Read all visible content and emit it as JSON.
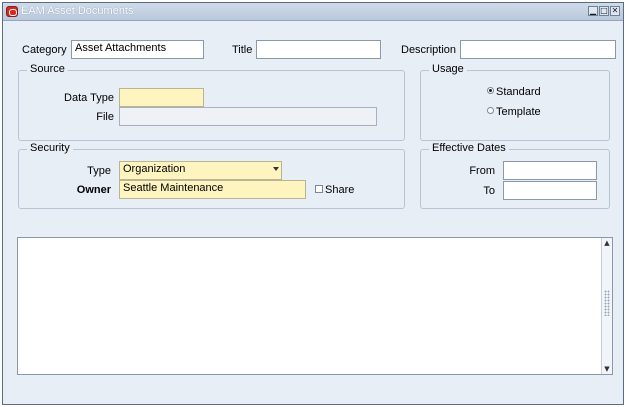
{
  "window": {
    "title": "EAM Asset Documents",
    "controls": [
      "▁",
      "□",
      "✕"
    ]
  },
  "header": {
    "category_label": "Category",
    "category_value": "Asset Attachments",
    "title_label": "Title",
    "title_value": "",
    "description_label": "Description",
    "description_value": ""
  },
  "source": {
    "group_label": "Source",
    "data_type_label": "Data Type",
    "data_type_value": "",
    "file_label": "File",
    "file_value": ""
  },
  "usage": {
    "group_label": "Usage",
    "options": [
      {
        "label": "Standard",
        "selected": true
      },
      {
        "label": "Template",
        "selected": false
      }
    ]
  },
  "security": {
    "group_label": "Security",
    "type_label": "Type",
    "type_value": "Organization",
    "owner_label": "Owner",
    "owner_value": "Seattle Maintenance",
    "share_label": "Share",
    "share_checked": false
  },
  "effective_dates": {
    "group_label": "Effective Dates",
    "from_label": "From",
    "from_value": "",
    "to_label": "To",
    "to_value": ""
  },
  "content": {
    "text": ""
  },
  "colors": {
    "required_field": "#fdf4c0",
    "window_bg": "#e8eef6",
    "titlebar": "#c5d3e5",
    "title_icon": "#d22a1e"
  }
}
